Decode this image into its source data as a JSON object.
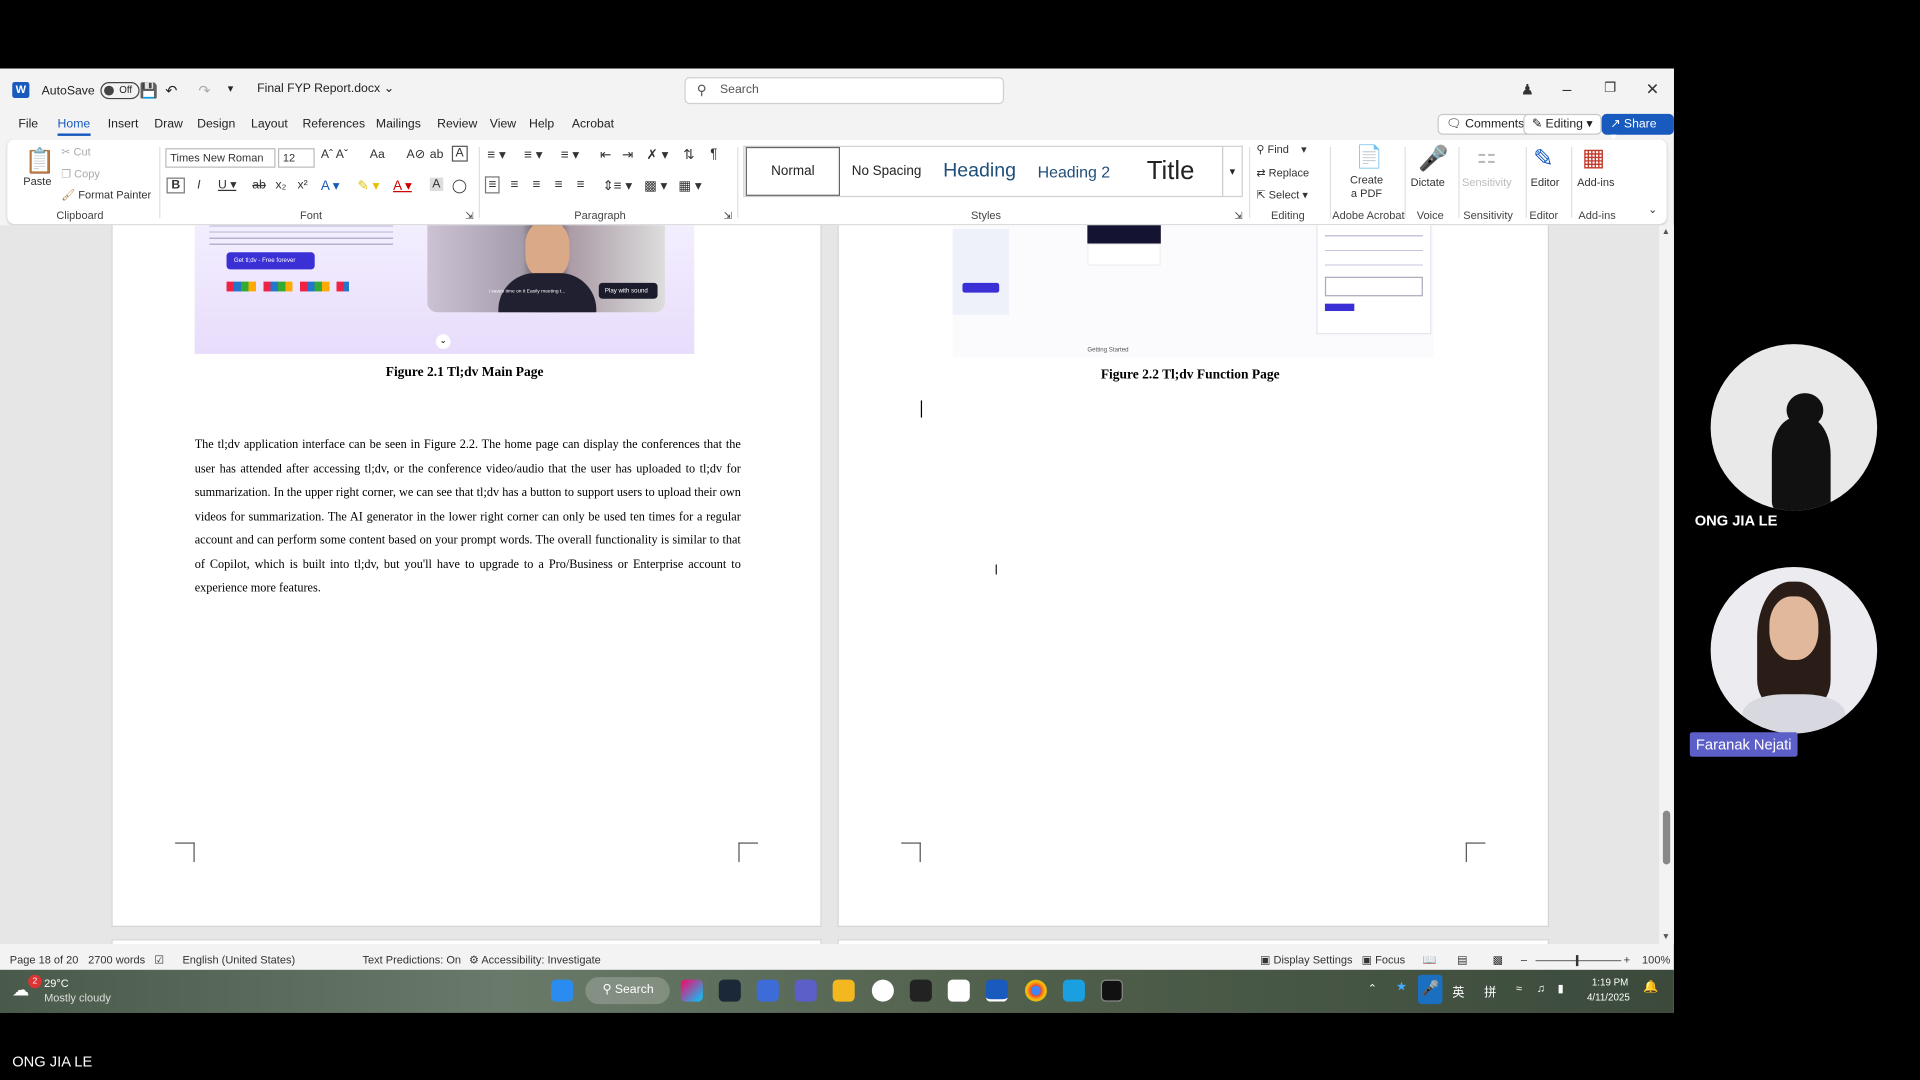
{
  "window": {
    "autosave_label": "AutoSave",
    "autosave_state": "Off",
    "file_name": "Final FYP Report.docx",
    "search_placeholder": "Search"
  },
  "menu": {
    "items": [
      "File",
      "Home",
      "Insert",
      "Draw",
      "Design",
      "Layout",
      "References",
      "Mailings",
      "Review",
      "View",
      "Help",
      "Acrobat"
    ],
    "active": "Home",
    "comments": "Comments",
    "editing": "Editing",
    "share": "Share"
  },
  "ribbon": {
    "clipboard": {
      "paste": "Paste",
      "cut": "Cut",
      "copy": "Copy",
      "format_painter": "Format Painter",
      "label": "Clipboard"
    },
    "font": {
      "family": "Times New Roman",
      "size": "12",
      "label": "Font"
    },
    "paragraph": {
      "label": "Paragraph"
    },
    "styles": {
      "normal": "Normal",
      "no_spacing": "No Spacing",
      "heading": "Heading",
      "heading2": "Heading 2",
      "title": "Title",
      "label": "Styles"
    },
    "editing": {
      "find": "Find",
      "replace": "Replace",
      "select": "Select",
      "label": "Editing"
    },
    "acrobat": {
      "create_pdf": "Create a PDF",
      "label": "Adobe Acrobat"
    },
    "voice": {
      "dictate": "Dictate",
      "label": "Voice"
    },
    "sensitivity": {
      "btn": "Sensitivity",
      "label": "Sensitivity"
    },
    "editor": {
      "btn": "Editor",
      "label": "Editor"
    },
    "addins": {
      "btn": "Add-ins",
      "label": "Add-ins"
    }
  },
  "document": {
    "left_shot": {
      "button": "Get tl;dv - Free forever",
      "video_label": "Play with sound",
      "caption_text": "I saves time on it Easily meeting t..."
    },
    "right_shot": {
      "note": "Getting Started"
    },
    "caption1": "Figure 2.1 Tl;dv Main Page",
    "caption2": "Figure 2.2 Tl;dv Function Page",
    "paragraph": "The tl;dv application interface can be seen in Figure 2.2. The home page can display the conferences that the user has attended after accessing tl;dv, or the conference video/audio that the user has uploaded to tl;dv for summarization. In the upper right corner, we can see that tl;dv has a button to support users to upload their own videos for summarization. The AI generator in the lower right corner can only be used ten times for a regular account and can perform some content based on your prompt words. The overall functionality is similar to that of Copilot, which is built into tl;dv, but you'll have to upgrade to a Pro/Business or Enterprise account to experience more features."
  },
  "status": {
    "page": "Page 18 of 20",
    "words": "2700 words",
    "language": "English (United States)",
    "predictions": "Text Predictions: On",
    "accessibility": "Accessibility: Investigate",
    "display_settings": "Display Settings",
    "focus": "Focus",
    "zoom": "100%"
  },
  "taskbar": {
    "weather_temp": "29°C",
    "weather_desc": "Mostly cloudy",
    "weather_badge": "2",
    "search": "Search",
    "time": "1:19 PM",
    "date": "4/11/2025",
    "ime": "英",
    "ime2": "拼"
  },
  "participants": {
    "p1": "ONG JIA LE",
    "p2": "Faranak Nejati",
    "self_label": "ONG JIA LE"
  },
  "colors": {
    "accent": "#185abd",
    "participant_badge": "#5c5fc7"
  }
}
